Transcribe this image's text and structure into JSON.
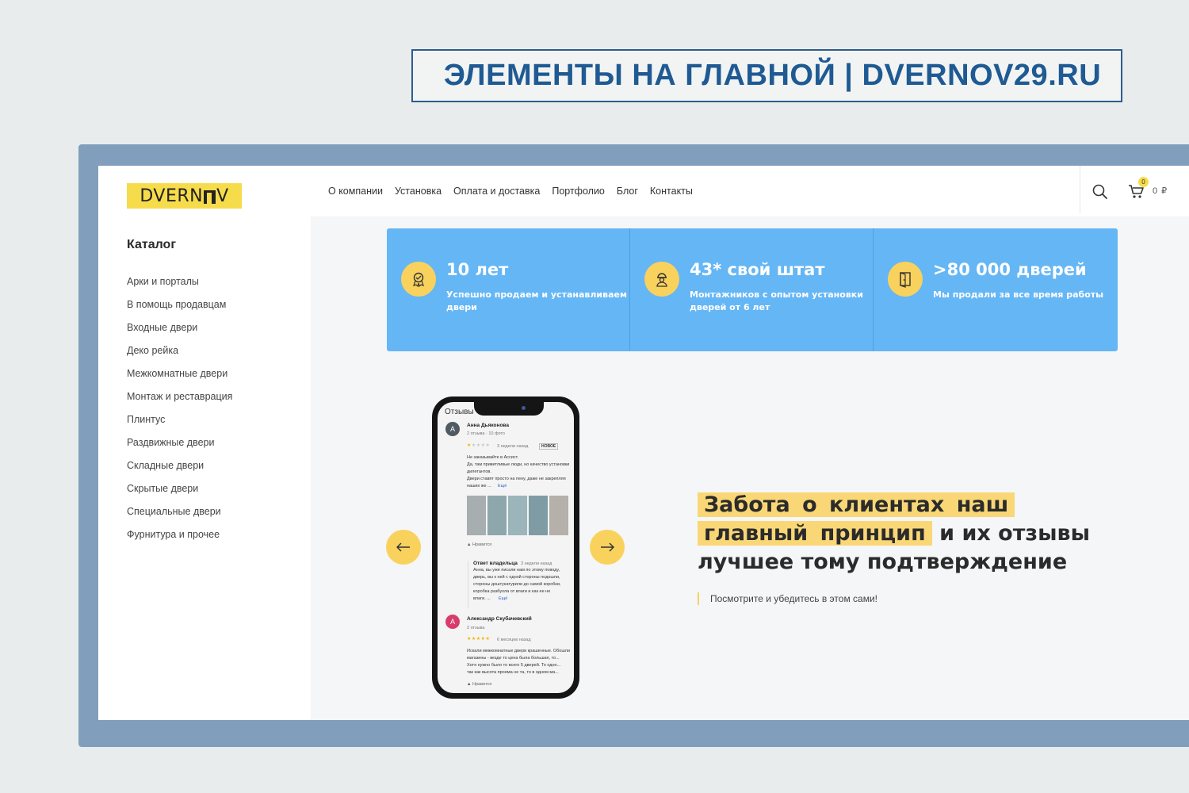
{
  "banner": {
    "title": "ЭЛЕМЕНТЫ НА ГЛАВНОЙ | DVERNOV29.RU"
  },
  "logo": {
    "part1": "DVERN",
    "part2": "V"
  },
  "catalog": {
    "title": "Каталог",
    "items": [
      "Арки и порталы",
      "В помощь продавцам",
      "Входные двери",
      "Деко рейка",
      "Межкомнатные двери",
      "Монтаж и реставрация",
      "Плинтус",
      "Раздвижные двери",
      "Складные двери",
      "Скрытые двери",
      "Специальные двери",
      "Фурнитура и прочее"
    ]
  },
  "nav": {
    "items": [
      "О компании",
      "Установка",
      "Оплата и доставка",
      "Портфолио",
      "Блог",
      "Контакты"
    ],
    "cart_count": "0",
    "cart_total": "0 ₽",
    "icons": {
      "search": "search-icon",
      "cart": "cart-icon"
    }
  },
  "stats": [
    {
      "icon": "award-icon",
      "title": "10 лет",
      "desc": "Успешно продаем и устанавливаем двери"
    },
    {
      "icon": "worker-icon",
      "title": "43* свой штат",
      "desc": "Монтажников с опытом установки дверей от 6 лет"
    },
    {
      "icon": "door-icon",
      "title": ">80 000 дверей",
      "desc": "Мы продали за все время работы"
    }
  ],
  "phone": {
    "tab": "Отзывы",
    "review1": {
      "avatar": "А",
      "name": "Анна Дьяконова",
      "meta": "2 отзыва · 10 фото",
      "stars": "★★★★★",
      "time": "3 недели назад",
      "badge": "НОВОЕ",
      "text": "Не заказывайте в Ассист.\nДа, там приветливые люди, но качество установки\nдилетантов.\nДвери ставят просто на пену, даже не закрепляя\nнаших же ...",
      "more": "Ещё",
      "like": "Нравится"
    },
    "owner": {
      "label": "Ответ владельца",
      "time": "3 недели назад",
      "text": "Анна, вы уже писали нам по этому поводу,\nдверь, вы к ней с одной стороны подошли,\nстороны доштукатурили до самой коробки,\nкоробка разбухла от влаги и как ее не\nвлаги. ...",
      "more": "Ещё"
    },
    "review2": {
      "avatar": "А",
      "name": "Александр Скубачевский",
      "meta": "2 отзыва",
      "stars": "★★★★★",
      "time": "6 месяцев назад",
      "text": "Искали межкомнатные двери крашенные. Обошли\nмагазины - везде то цена была большая, то...\nХотя нужно было то всего 5 дверей. То одно...\nтак как высота проема не та, то в одном ма...",
      "like": "Нравится"
    }
  },
  "slider": {
    "prev_icon": "arrow-left-icon",
    "next_icon": "arrow-right-icon"
  },
  "promo": {
    "hl1": "Забота о клиентах наш",
    "hl2": "главный принцип",
    "rest2": "и их отзывы",
    "line3": "лучшее тому подтверждение",
    "subtext": "Посмотрите и убедитесь в этом сами!"
  },
  "colors": {
    "accent": "#f9d25e",
    "stat_bg": "#65b6f5",
    "frame": "#819fbd",
    "banner_text": "#1f5a93"
  }
}
